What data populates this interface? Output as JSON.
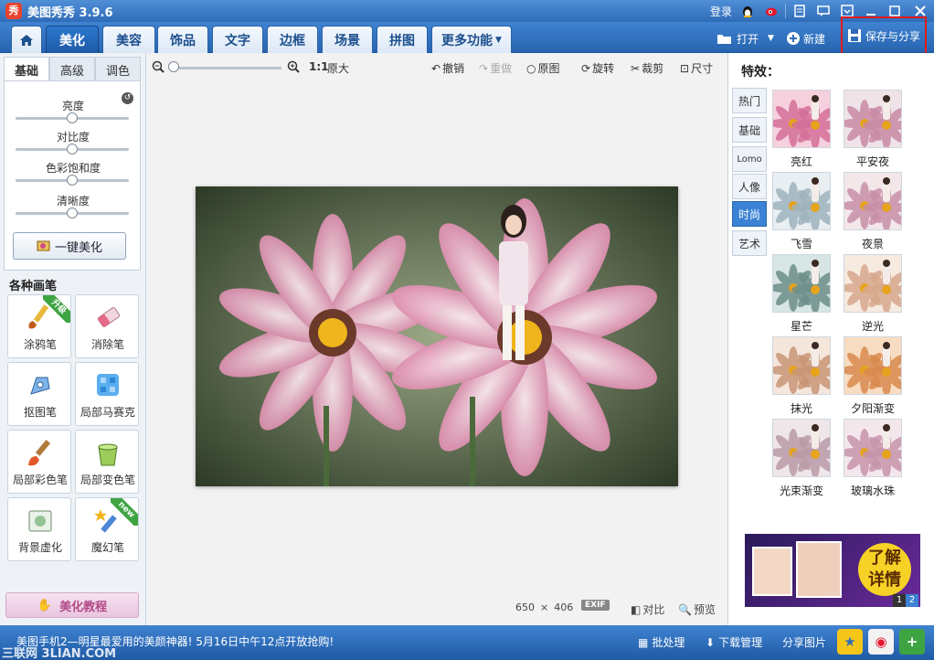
{
  "titlebar": {
    "logo_text": "秀",
    "title": "美图秀秀 3.9.6",
    "login": "登录",
    "icons": [
      "qq-icon",
      "weibo-icon",
      "feedback-icon",
      "message-icon",
      "settings-icon",
      "minimize-icon",
      "maximize-icon",
      "close-icon"
    ]
  },
  "tabs": [
    "美化",
    "美容",
    "饰品",
    "文字",
    "边框",
    "场景",
    "拼图",
    "更多功能"
  ],
  "tab_actions": {
    "open": "打开",
    "new": "新建",
    "save_share": "保存与分享"
  },
  "left": {
    "subtabs": [
      "基础",
      "高级",
      "调色"
    ],
    "sliders": [
      {
        "label": "亮度",
        "value": 0.5
      },
      {
        "label": "对比度",
        "value": 0.5
      },
      {
        "label": "色彩饱和度",
        "value": 0.5
      },
      {
        "label": "清晰度",
        "value": 0.5
      }
    ],
    "onekey": "一键美化",
    "brush_header": "各种画笔",
    "brushes": [
      {
        "label": "涂鸦笔",
        "badge": "升级"
      },
      {
        "label": "消除笔",
        "badge": ""
      },
      {
        "label": "抠图笔",
        "badge": ""
      },
      {
        "label": "局部马赛克",
        "badge": ""
      },
      {
        "label": "局部彩色笔",
        "badge": ""
      },
      {
        "label": "局部变色笔",
        "badge": ""
      },
      {
        "label": "背景虚化",
        "badge": ""
      },
      {
        "label": "魔幻笔",
        "badge": "new"
      }
    ],
    "tutorial": "美化教程"
  },
  "canvas": {
    "zoom_ratio": "1:1",
    "original_size": "原大",
    "tools": [
      "撤销",
      "重做",
      "原图",
      "旋转",
      "裁剪",
      "尺寸"
    ],
    "image_width": "650",
    "image_height": "406",
    "size_sep": "×",
    "exif": "EXIF",
    "compare": "对比",
    "preview": "预览"
  },
  "effects": {
    "title": "特效：",
    "categories": [
      "热门",
      "基础",
      "Lomo",
      "人像",
      "时尚",
      "艺术"
    ],
    "active_category": "时尚",
    "items": [
      "亮红",
      "平安夜",
      "飞雪",
      "夜景",
      "星芒",
      "逆光",
      "抹光",
      "夕阳渐变",
      "光束渐变",
      "玻璃水珠"
    ],
    "ad_badge_line1": "了解",
    "ad_badge_line2": "详情",
    "ad_pages": [
      "1",
      "2"
    ]
  },
  "statusbar": {
    "news": "美图手机2—明星最爱用的美颜神器! 5月16日中午12点开放抢购!",
    "watermark": "三联网 3LIAN.COM",
    "batch": "批处理",
    "download": "下载管理",
    "share_image": "分享图片"
  },
  "colors": {
    "accent": "#2f6cb8",
    "highlight_box": "#e01b1b",
    "active_tab": "#1e5aa6"
  }
}
